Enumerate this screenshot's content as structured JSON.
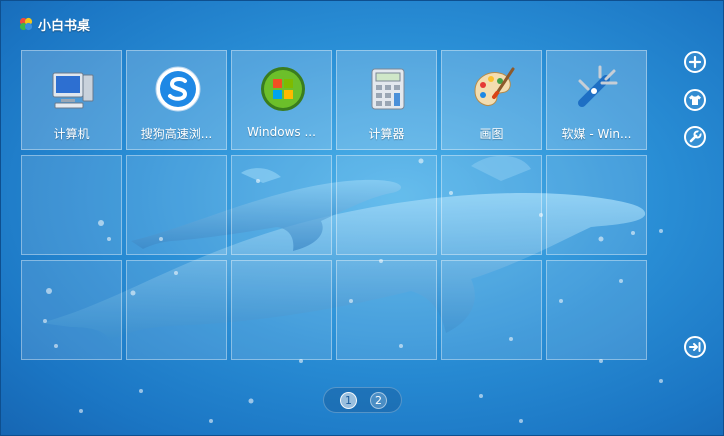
{
  "window": {
    "title": "小白书桌"
  },
  "tiles": [
    {
      "label": "计算机",
      "icon": "computer-icon"
    },
    {
      "label": "搜狗高速浏...",
      "icon": "sogou-browser-icon"
    },
    {
      "label": "Windows ...",
      "icon": "windows-media-player-icon"
    },
    {
      "label": "计算器",
      "icon": "calculator-icon"
    },
    {
      "label": "画图",
      "icon": "paint-palette-icon"
    },
    {
      "label": "软媒 - Win...",
      "icon": "ruanmei-tools-icon"
    }
  ],
  "side_buttons": [
    {
      "icon": "plus-icon"
    },
    {
      "icon": "tshirt-skin-icon"
    },
    {
      "icon": "wrench-settings-icon"
    },
    {
      "icon": "collapse-to-edge-icon"
    }
  ],
  "pager": {
    "pages": [
      "1",
      "2"
    ],
    "active_page": "1"
  },
  "colors": {
    "background": "#2a8fd6",
    "tile_border": "#ffffff"
  }
}
